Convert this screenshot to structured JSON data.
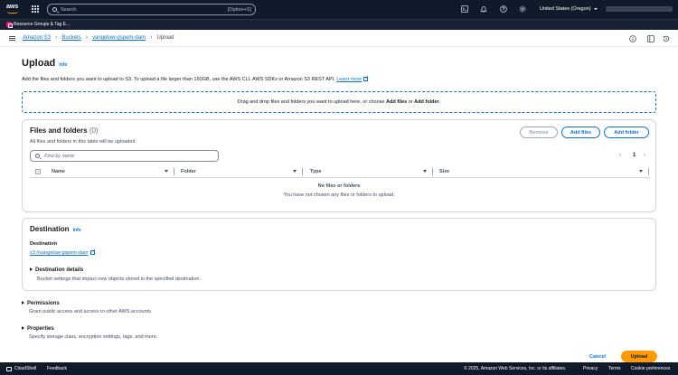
{
  "topnav": {
    "logo": "aws",
    "search_placeholder": "Search",
    "search_shortcut": "[Option+S]",
    "region": "United States (Oregon)",
    "icons": [
      "cloudshell-icon",
      "bell-icon",
      "help-icon",
      "gear-icon"
    ]
  },
  "favorites": [
    {
      "label": "Resource Groups & Tag E..."
    }
  ],
  "breadcrumb": [
    "Amazon S3",
    "Buckets",
    "vangeluw-gspem-dam",
    "Upload"
  ],
  "page": {
    "title": "Upload",
    "info": "Info",
    "description": "Add the files and folders you want to upload to S3. To upload a file larger than 160GB, use the AWS CLI, AWS SDKs or Amazon S3 REST API.",
    "learn_more": "Learn more"
  },
  "dropzone": {
    "prefix": "Drag and drop files and folders you want to upload here, or choose ",
    "add_files": "Add files",
    "or": " or ",
    "add_folder": "Add folder",
    "suffix": "."
  },
  "files_panel": {
    "title": "Files and folders",
    "count": "(0)",
    "description": "All files and folders in this table will be uploaded.",
    "remove": "Remove",
    "add_files": "Add files",
    "add_folder": "Add folder",
    "find_placeholder": "Find by name",
    "page": "1",
    "columns": [
      "Name",
      "Folder",
      "Type",
      "Size"
    ],
    "empty_title": "No files or folders",
    "empty_desc": "You have not chosen any files or folders to upload."
  },
  "destination": {
    "title": "Destination",
    "info": "Info",
    "label": "Destination",
    "link": "s3://vangeluw-gspem-dam",
    "details_title": "Destination details",
    "details_desc": "Bucket settings that impact new objects stored in the specified destination."
  },
  "permissions": {
    "title": "Permissions",
    "desc": "Grant public access and access to other AWS accounts."
  },
  "properties": {
    "title": "Properties",
    "desc": "Specify storage class, encryption settings, tags, and more."
  },
  "actions": {
    "cancel": "Cancel",
    "upload": "Upload"
  },
  "footer": {
    "cloudshell": "CloudShell",
    "feedback": "Feedback",
    "copyright": "© 2025, Amazon Web Services, Inc. or its affiliates.",
    "privacy": "Privacy",
    "terms": "Terms",
    "cookies": "Cookie preferences"
  },
  "colors": {
    "accent": "#0972d3",
    "primary_button": "#ff9900",
    "nav_bg": "#0f1b2a"
  }
}
